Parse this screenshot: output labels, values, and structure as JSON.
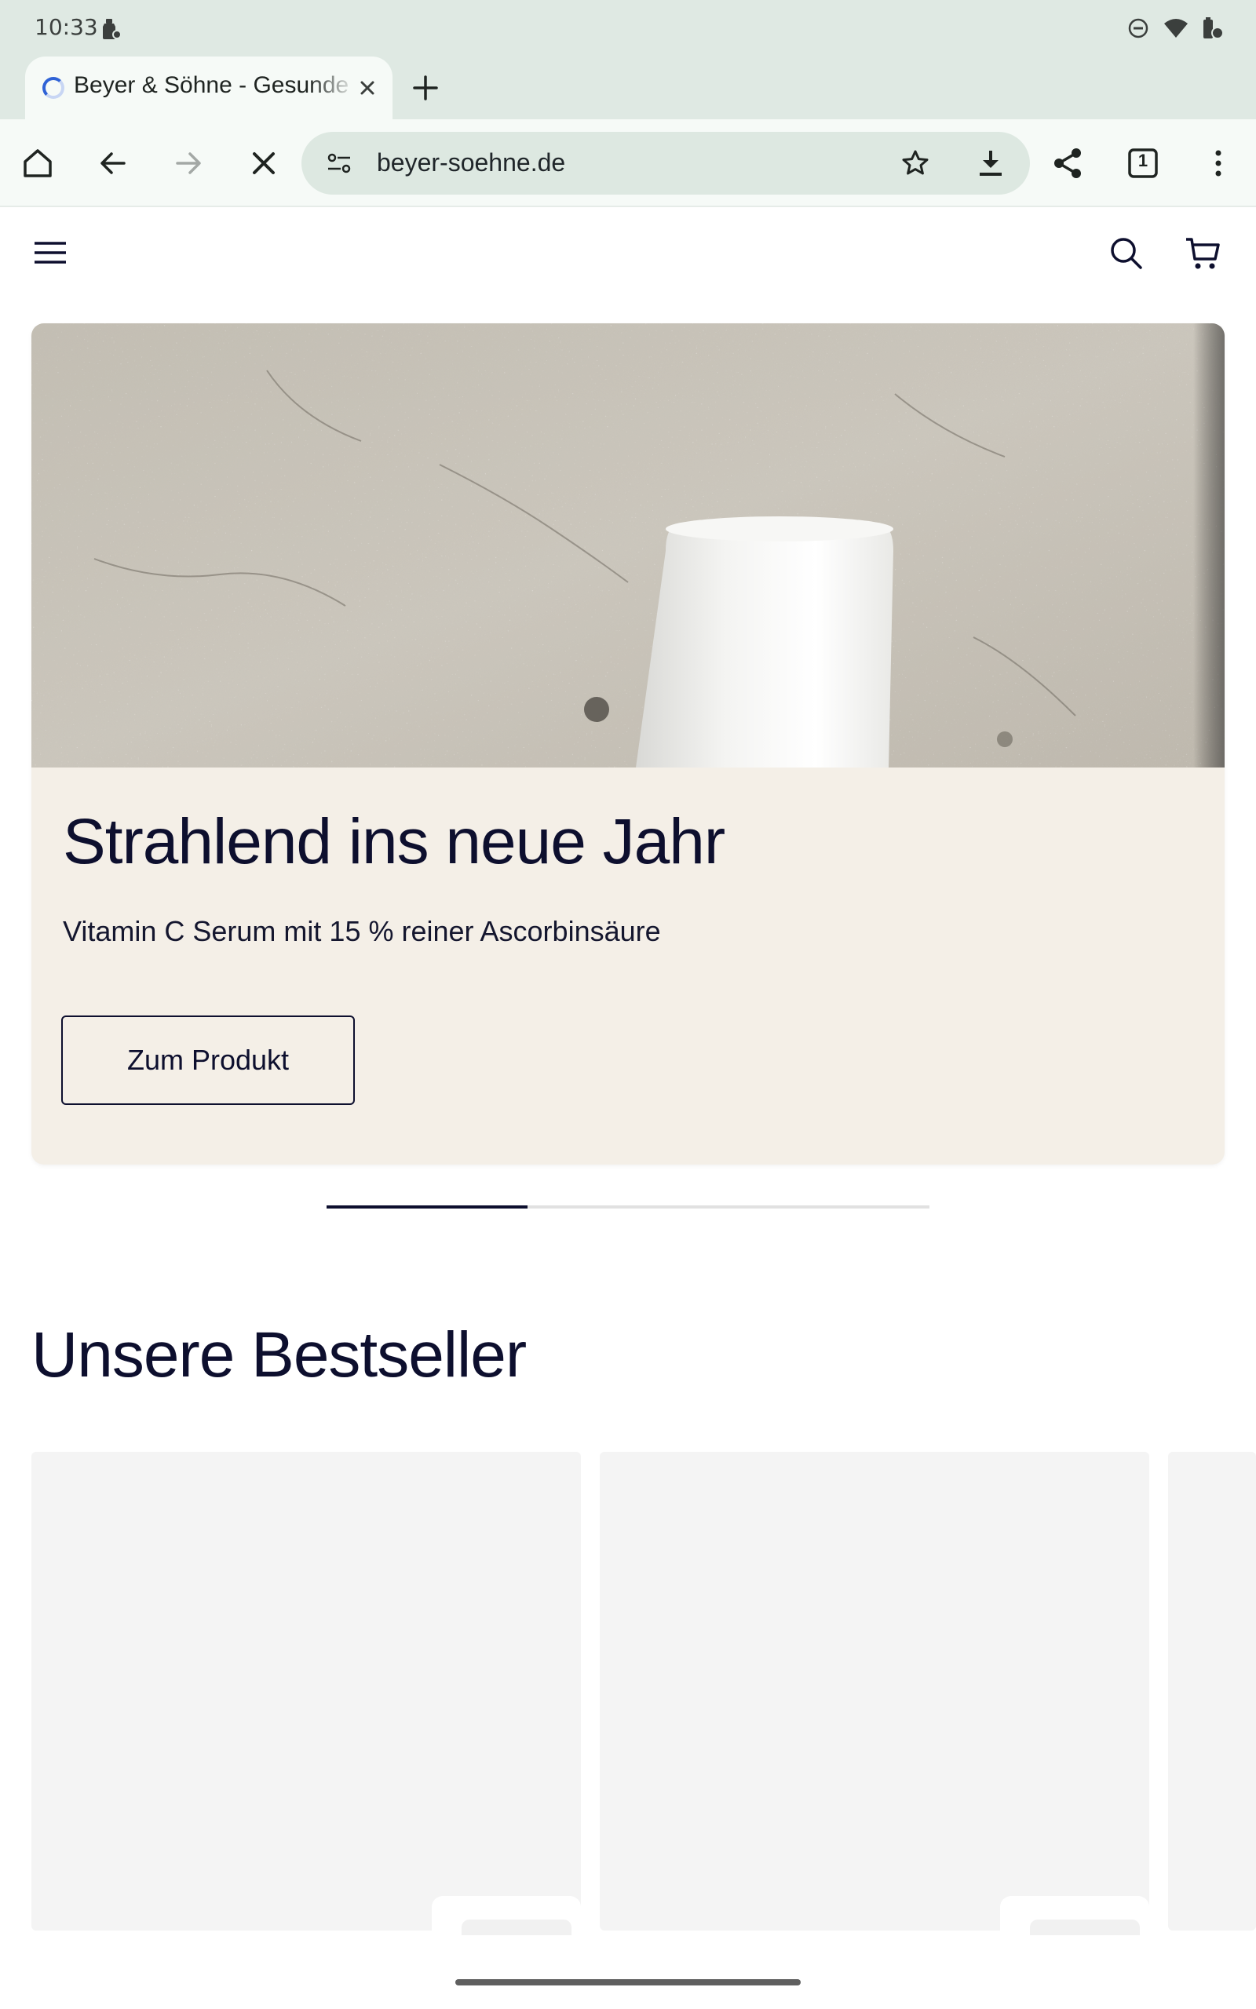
{
  "status_bar": {
    "time": "10:33",
    "icons": [
      "cleaner-icon",
      "do-not-disturb-icon",
      "wifi-icon",
      "battery-icon"
    ]
  },
  "browser": {
    "tab_title": "Beyer & Söhne - Gesunde Haut",
    "url": "beyer-soehne.de",
    "tab_count": "1"
  },
  "hero": {
    "title": "Strahlend ins neue Jahr",
    "subtitle": "Vitamin C Serum mit 15 % reiner Ascorbinsäure",
    "cta_label": "Zum Produkt",
    "slide_progress": 0.333
  },
  "bestsellers": {
    "title": "Unsere Bestseller"
  },
  "colors": {
    "browser_chrome": "#dfe9e3",
    "text_navy": "#0d0f2e",
    "hero_bg": "#f4efe7",
    "placeholder": "#f4f4f4"
  }
}
